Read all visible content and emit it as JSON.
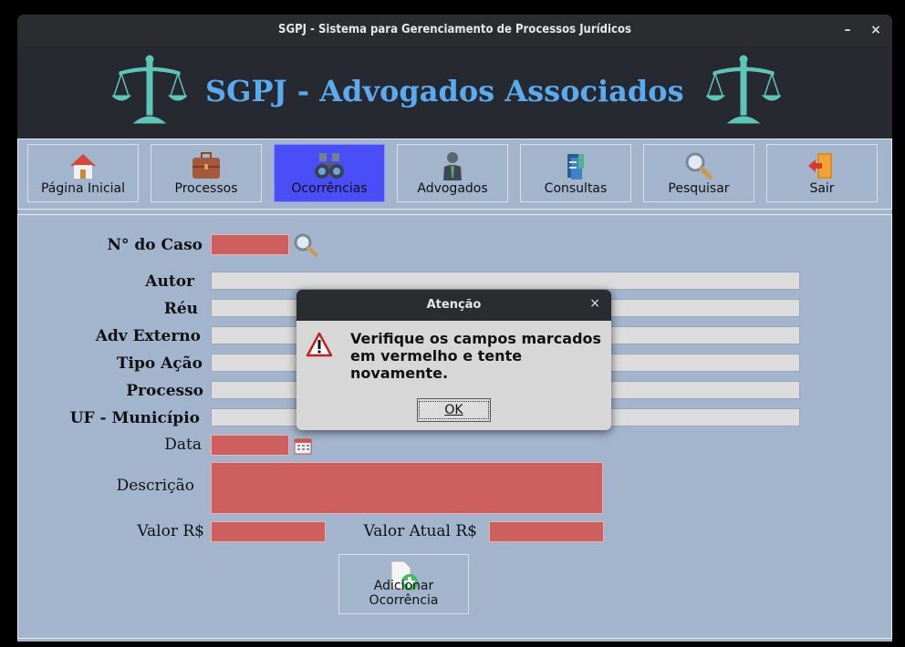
{
  "window": {
    "title": "SGPJ - Sistema para Gerenciamento de Processos Jurídicos",
    "minimize": "–",
    "close": "×"
  },
  "header": {
    "brand": "SGPJ - Advogados Associados",
    "accent_color": "#5aaaf0"
  },
  "toolbar": {
    "active_color": "#4a4ef6",
    "items": [
      {
        "label": "Página Inicial",
        "icon": "home-icon"
      },
      {
        "label": "Processos",
        "icon": "briefcase-icon"
      },
      {
        "label": "Ocorrências",
        "icon": "binoculars-icon",
        "active": true
      },
      {
        "label": "Advogados",
        "icon": "lawyer-icon"
      },
      {
        "label": "Consultas",
        "icon": "books-icon"
      },
      {
        "label": "Pesquisar",
        "icon": "magnifier-icon"
      },
      {
        "label": "Sair",
        "icon": "exit-door-icon"
      }
    ]
  },
  "form": {
    "error_color": "#cd5f5f",
    "labels": {
      "caso": "N° do Caso",
      "autor": "Autor",
      "reu": "Réu",
      "adv_externo": "Adv Externo",
      "tipo_acao": "Tipo Ação",
      "processo": "Processo",
      "uf_municipio": "UF - Município",
      "data": "Data",
      "descricao": "Descrição",
      "valor": "Valor R$",
      "valor_atual": "Valor Atual R$"
    },
    "values": {
      "caso": "",
      "autor": "",
      "reu": "",
      "adv_externo": "",
      "tipo_acao": "",
      "processo": "",
      "uf_municipio": "",
      "data": "",
      "descricao": "",
      "valor": "",
      "valor_atual": ""
    },
    "add_button": "Adicionar Ocorrência"
  },
  "dialog": {
    "title": "Atenção",
    "close": "×",
    "message": "Verifique os campos marcados em vermelho e tente novamente.",
    "ok": "OK"
  }
}
